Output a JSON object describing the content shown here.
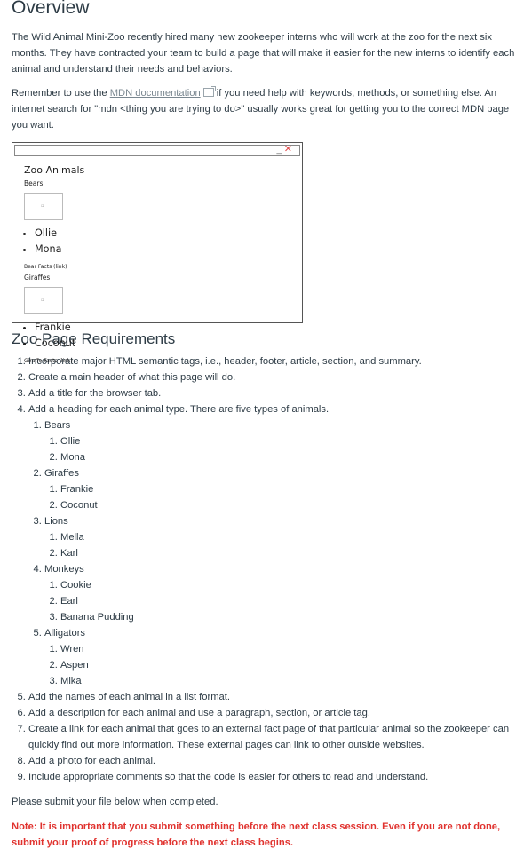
{
  "headings": {
    "overview": "Overview",
    "requirements": "Zoo Page Requirements"
  },
  "intro": {
    "p1": "The Wild Animal Mini-Zoo recently hired many new zookeeper interns who will work at the zoo for the next six months. They have contracted your team to build a page that will make it easier for the new interns to identify each animal and understand their needs and behaviors.",
    "p2_before": "Remember to use the ",
    "p2_link": "MDN documentation",
    "p2_after": " if you need help with keywords, methods, or something else. An internet search for \"mdn <thing you are trying to do>\" usually works great for getting you to the correct MDN page you want."
  },
  "mockup": {
    "minimize": "_",
    "close": "✕",
    "title": "Zoo Animals",
    "bears": {
      "heading": "Bears",
      "names": [
        "Ollie",
        "Mona"
      ],
      "fact": "Bear Facts (link)"
    },
    "giraffes": {
      "heading": "Giraffes",
      "names": [
        "Frankie",
        "Coconut"
      ],
      "fact": "Giraffe Facts (link)"
    }
  },
  "requirements": {
    "r1": "Incorporate major HTML semantic tags, i.e., header, footer, article, section, and summary.",
    "r2": "Create a main header of what this page will do.",
    "r3": "Add a title for the browser tab.",
    "r4": "Add a heading for each animal type. There are five types of animals.",
    "animals": [
      {
        "type": "Bears",
        "names": [
          "Ollie",
          "Mona"
        ]
      },
      {
        "type": "Giraffes",
        "names": [
          "Frankie",
          "Coconut"
        ]
      },
      {
        "type": "Lions",
        "names": [
          "Mella",
          "Karl"
        ]
      },
      {
        "type": "Monkeys",
        "names": [
          "Cookie",
          "Earl",
          "Banana Pudding"
        ]
      },
      {
        "type": "Alligators",
        "names": [
          "Wren",
          "Aspen",
          "Mika"
        ]
      }
    ],
    "r5": "Add the names of each animal in a list format.",
    "r6": "Add a description for each animal and use a paragraph, section, or article tag.",
    "r7": "Create a link for each animal that goes to an external fact page of that particular animal so the zookeeper can quickly find out more information. These external pages can link to other outside websites.",
    "r8": "Add a photo for each animal.",
    "r9": "Include appropriate comments so that the code is easier for others to read and understand."
  },
  "submit": "Please submit your file below when completed.",
  "note": "Note: It is important that you submit something before the next class session. Even if you are not done, submit your proof of progress before the next class begins."
}
